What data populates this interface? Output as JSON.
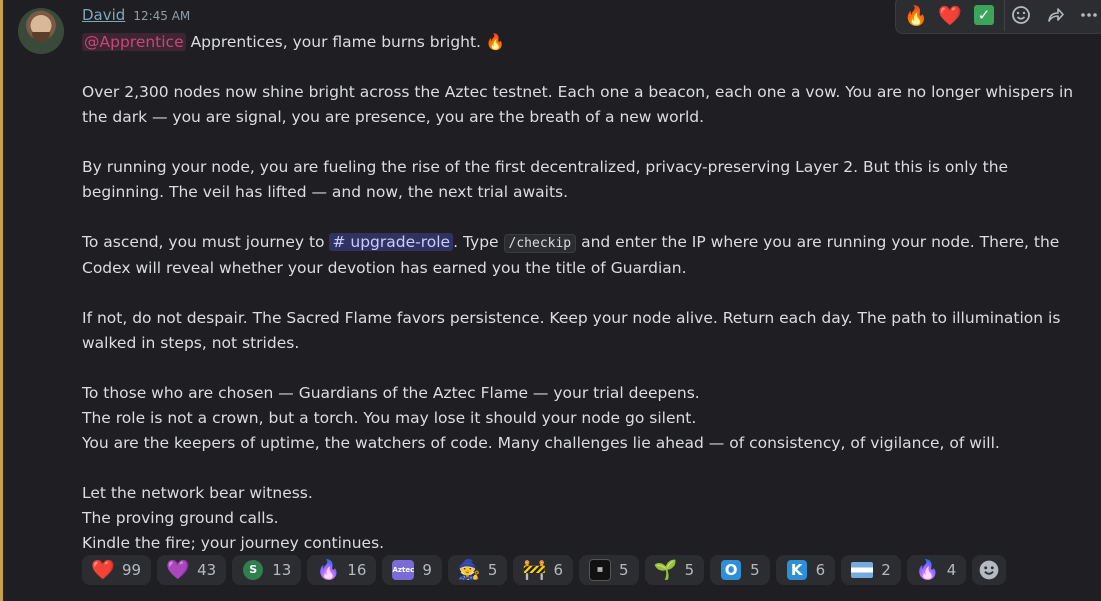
{
  "message": {
    "author": "David",
    "timestamp": "12:45 AM",
    "mention": "@Apprentice",
    "intro_text": "Apprentices, your flame burns bright.",
    "intro_emoji": "🔥",
    "p1": "Over 2,300 nodes now shine bright across the Aztec testnet. Each one a beacon, each one a vow. You are no longer whispers in the dark — you are signal, you are presence, you are the breath of a new world.",
    "p2": "By running your node, you are fueling the rise of the first decentralized, privacy-preserving Layer 2. But this is only the beginning. The veil has lifted — and now, the next trial awaits.",
    "p3_before": "To ascend, you must journey to",
    "p3_channel": "# upgrade-role",
    "p3_mid": ". Type",
    "p3_command": "/checkip",
    "p3_after": "and enter the IP where you are running your node. There, the Codex will reveal whether your devotion has earned you the title of Guardian.",
    "p4": "If not, do not despair. The Sacred Flame favors persistence. Keep your node alive. Return each day. The path to illumination is walked in steps, not strides.",
    "p5_lines": [
      "To those who are chosen — Guardians of the Aztec Flame — your trial deepens.",
      "The role is not a crown, but a torch. You may lose it should your node go silent.",
      "You are the keepers of uptime, the watchers of code. Many challenges lie ahead — of consistency, of vigilance, of will."
    ],
    "p6_lines": [
      "Let the network bear witness.",
      "The proving ground calls.",
      "Kindle the fire; your journey continues."
    ]
  },
  "hover_bar": {
    "quick_reactions": [
      "🔥",
      "❤️",
      "✓"
    ],
    "icons": [
      "add-reaction-icon",
      "forward-icon",
      "more-icon"
    ]
  },
  "reactions": [
    {
      "emoji": "❤️",
      "count": "99"
    },
    {
      "emoji": "💜",
      "count": "43"
    },
    {
      "emoji": "S",
      "count": "13"
    },
    {
      "emoji": "🔥",
      "count": "16"
    },
    {
      "emoji": "Aztec",
      "count": "9"
    },
    {
      "emoji": "🧙",
      "count": "5"
    },
    {
      "emoji": "🚧",
      "count": "6"
    },
    {
      "emoji": "▦",
      "count": "5"
    },
    {
      "emoji": "🌱",
      "count": "5"
    },
    {
      "emoji": "O",
      "count": "5"
    },
    {
      "emoji": "K",
      "count": "6"
    },
    {
      "emoji": "flag-ar",
      "count": "2"
    },
    {
      "emoji": "🔥",
      "count": "4"
    }
  ],
  "colors": {
    "background": "#1f1f23",
    "mention": "#c9467a",
    "channel_bg": "#3b3f8a",
    "author": "#7fa7b8"
  }
}
